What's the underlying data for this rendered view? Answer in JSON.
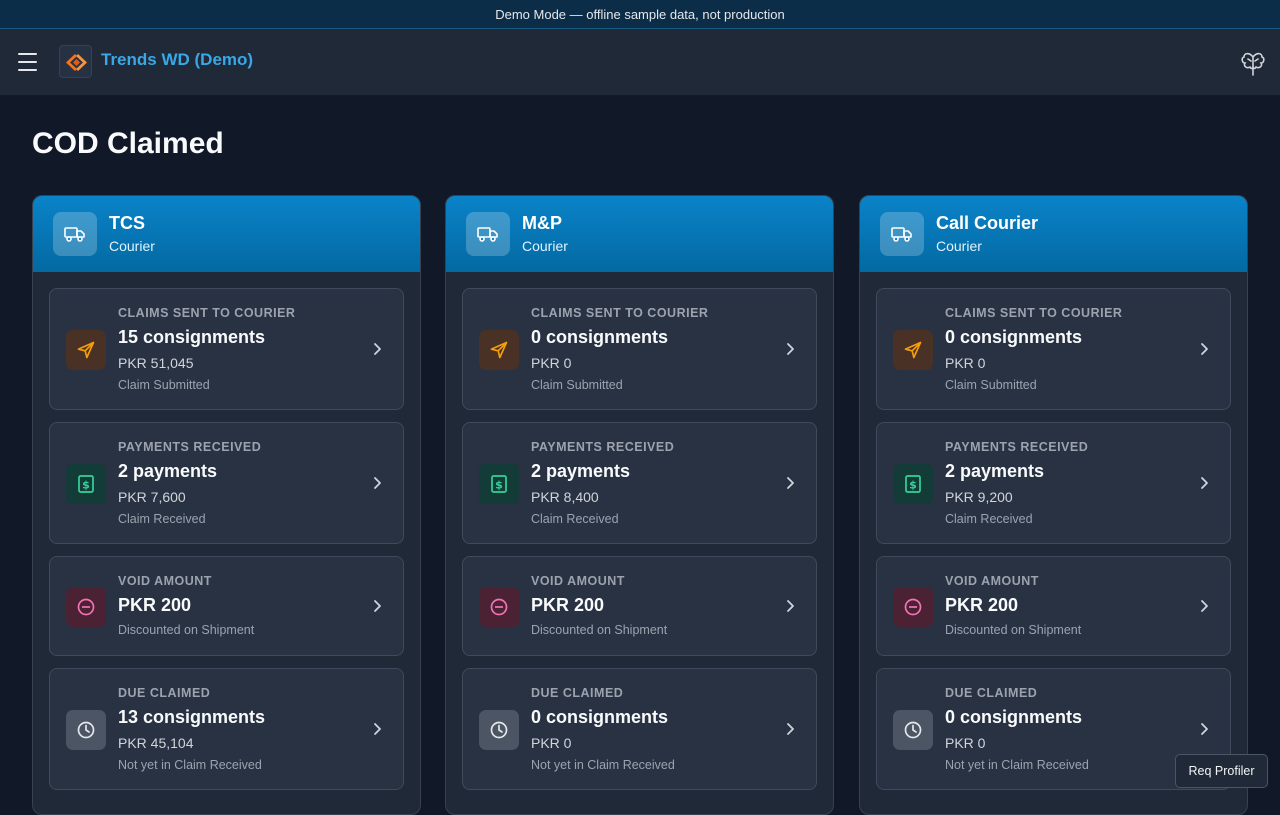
{
  "banner": {
    "text": "Demo Mode — offline sample data, not production"
  },
  "header": {
    "brand": "Trends WD (Demo)",
    "menu_icon": "hamburger-icon",
    "profile_icon": "brain-icon"
  },
  "page": {
    "title": "COD Claimed"
  },
  "couriers": [
    {
      "name": "TCS",
      "subtitle": "Courier",
      "cards": [
        {
          "label": "CLAIMS SENT TO COURIER",
          "main": "15 consignments",
          "amount": "PKR 51,045",
          "note": "Claim Submitted"
        },
        {
          "label": "PAYMENTS RECEIVED",
          "main": "2 payments",
          "amount": "PKR 7,600",
          "note": "Claim Received"
        },
        {
          "label": "VOID AMOUNT",
          "main": "PKR 200",
          "note": "Discounted on Shipment"
        },
        {
          "label": "DUE CLAIMED",
          "main": "13 consignments",
          "amount": "PKR 45,104",
          "note": "Not yet in Claim Received"
        }
      ]
    },
    {
      "name": "M&P",
      "subtitle": "Courier",
      "cards": [
        {
          "label": "CLAIMS SENT TO COURIER",
          "main": "0 consignments",
          "amount": "PKR 0",
          "note": "Claim Submitted"
        },
        {
          "label": "PAYMENTS RECEIVED",
          "main": "2 payments",
          "amount": "PKR 8,400",
          "note": "Claim Received"
        },
        {
          "label": "VOID AMOUNT",
          "main": "PKR 200",
          "note": "Discounted on Shipment"
        },
        {
          "label": "DUE CLAIMED",
          "main": "0 consignments",
          "amount": "PKR 0",
          "note": "Not yet in Claim Received"
        }
      ]
    },
    {
      "name": "Call Courier",
      "subtitle": "Courier",
      "cards": [
        {
          "label": "CLAIMS SENT TO COURIER",
          "main": "0 consignments",
          "amount": "PKR 0",
          "note": "Claim Submitted"
        },
        {
          "label": "PAYMENTS RECEIVED",
          "main": "2 payments",
          "amount": "PKR 9,200",
          "note": "Claim Received"
        },
        {
          "label": "VOID AMOUNT",
          "main": "PKR 200",
          "note": "Discounted on Shipment"
        },
        {
          "label": "DUE CLAIMED",
          "main": "0 consignments",
          "amount": "PKR 0",
          "note": "Not yet in Claim Received"
        }
      ]
    }
  ],
  "icons": {
    "claims": "send-icon",
    "payments": "dollar-bill-icon",
    "void": "minus-circle-icon",
    "due": "clock-icon",
    "courier": "truck-icon"
  },
  "colors": {
    "accent": "#38a8e8",
    "header_gradient": "#0a83c9",
    "orange": "#f59e0b",
    "green": "#34d399",
    "red": "#f472b6"
  },
  "profiler": {
    "label": "Req Profiler"
  }
}
